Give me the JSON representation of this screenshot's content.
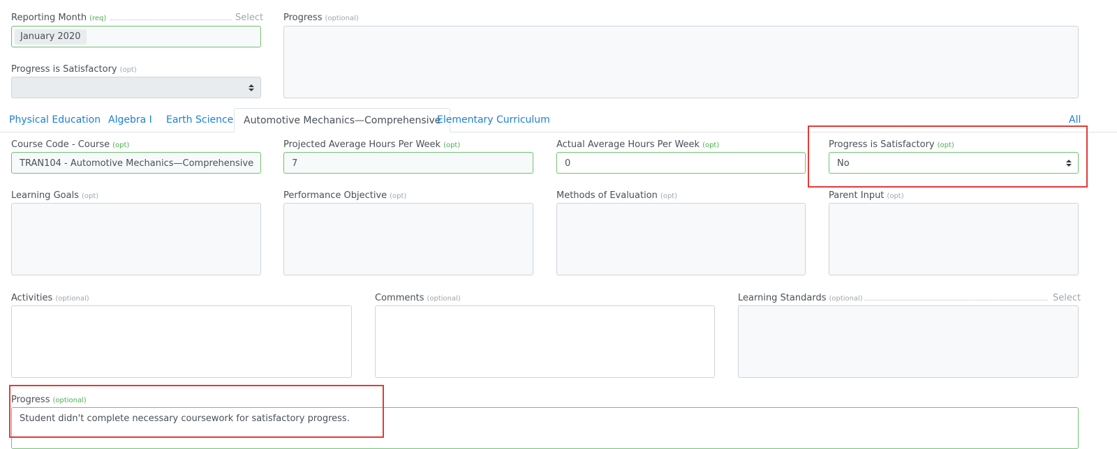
{
  "top": {
    "reporting_month": {
      "label": "Reporting Month",
      "tag": "(req)",
      "select_link": "Select",
      "chip": "January 2020"
    },
    "progress_satisfactory": {
      "label": "Progress is Satisfactory",
      "tag": "(opt)",
      "value": ""
    },
    "progress": {
      "label": "Progress",
      "tag": "(optional)",
      "value": ""
    }
  },
  "tabs": [
    {
      "label": "Physical Education",
      "active": false
    },
    {
      "label": "Algebra I",
      "active": false
    },
    {
      "label": "Earth Science",
      "active": false
    },
    {
      "label": "Automotive Mechanics—Comprehensive",
      "active": true
    },
    {
      "label": "Elementary Curriculum",
      "active": false
    }
  ],
  "all_link": "All",
  "course_fields": {
    "course_code": {
      "label": "Course Code - Course",
      "tag": "(opt)",
      "value": "TRAN104 - Automotive Mechanics—Comprehensive"
    },
    "projected_hours": {
      "label": "Projected Average Hours Per Week",
      "tag": "(opt)",
      "value": "7"
    },
    "actual_hours": {
      "label": "Actual Average Hours Per Week",
      "tag": "(opt)",
      "value": "0"
    },
    "progress_satisfactory": {
      "label": "Progress is Satisfactory",
      "tag": "(opt)",
      "value": "No"
    }
  },
  "text_areas_row1": {
    "learning_goals": {
      "label": "Learning Goals",
      "tag": "(opt)"
    },
    "performance_objective": {
      "label": "Performance Objective",
      "tag": "(opt)"
    },
    "methods_of_evaluation": {
      "label": "Methods of Evaluation",
      "tag": "(opt)"
    },
    "parent_input": {
      "label": "Parent Input",
      "tag": "(opt)"
    }
  },
  "text_areas_row2": {
    "activities": {
      "label": "Activities",
      "tag": "(optional)"
    },
    "comments": {
      "label": "Comments",
      "tag": "(optional)"
    },
    "learning_standards": {
      "label": "Learning Standards",
      "tag": "(optional)",
      "select_link": "Select"
    }
  },
  "bottom_progress": {
    "label": "Progress",
    "tag": "(optional)",
    "value": "Student didn't complete necessary coursework for satisfactory progress."
  },
  "colors": {
    "accent": "#1a7fd8",
    "valid_border": "#6fc36f",
    "highlight": "#e53935"
  }
}
